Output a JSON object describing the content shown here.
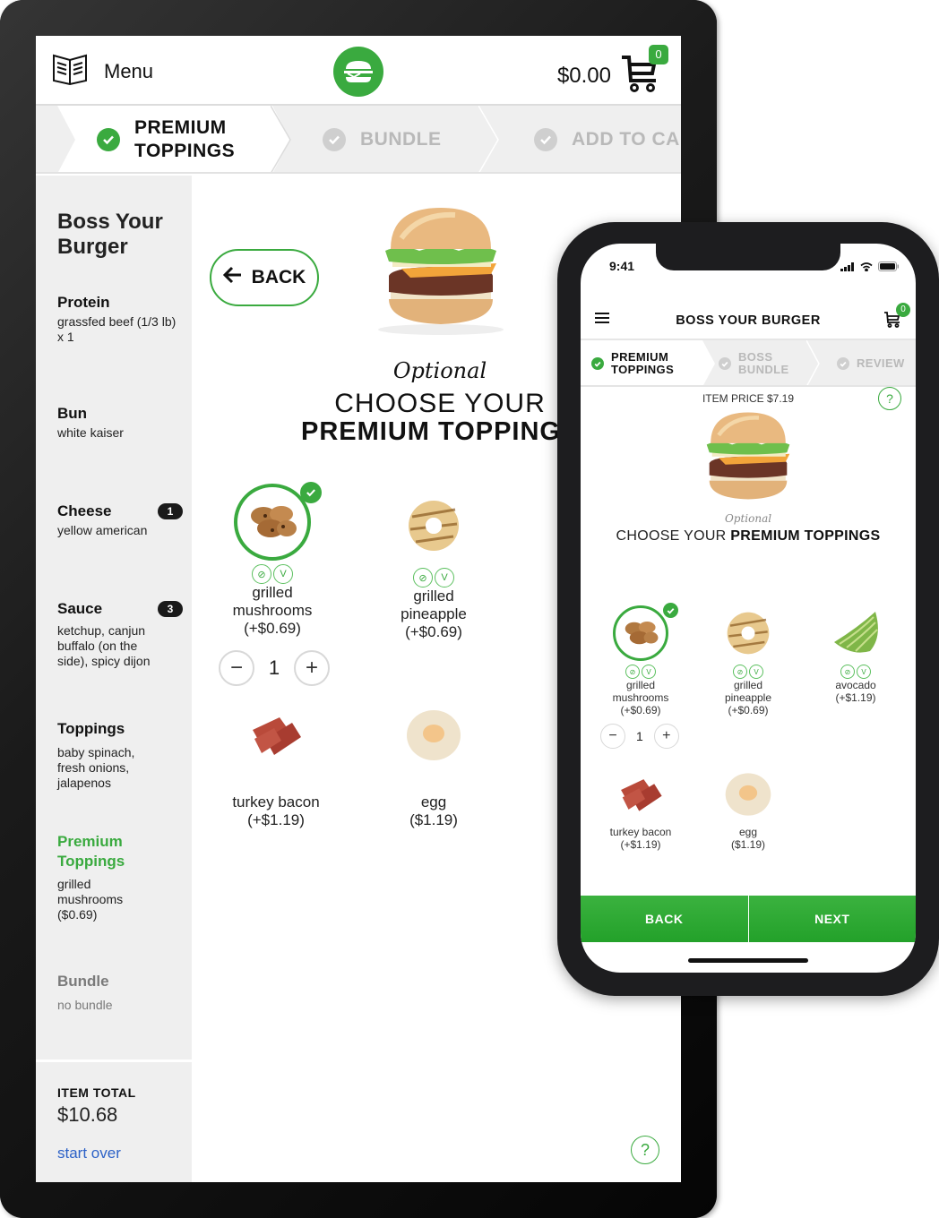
{
  "tablet": {
    "header": {
      "menu_label": "Menu",
      "cart_total": "$0.00",
      "cart_count": "0"
    },
    "steps": [
      {
        "line1": "PREMIUM",
        "line2": "TOPPINGS",
        "state": "active"
      },
      {
        "line1": "BUNDLE",
        "line2": "",
        "state": "inactive"
      },
      {
        "line1": "ADD TO CA",
        "line2": "",
        "state": "inactive"
      }
    ],
    "sidebar": {
      "title_line1": "Boss Your",
      "title_line2": "Burger",
      "sections": [
        {
          "title": "Protein",
          "value": "grassfed beef (1/3 lb) x 1",
          "badge": ""
        },
        {
          "title": "Bun",
          "value": "white kaiser",
          "badge": ""
        },
        {
          "title": "Cheese",
          "value": "yellow american",
          "badge": "1"
        },
        {
          "title": "Sauce",
          "value": "ketchup, canjun buffalo (on the side), spicy dijon",
          "badge": "3"
        },
        {
          "title": "Toppings",
          "value": "baby spinach, fresh onions, jalapenos",
          "badge": ""
        },
        {
          "title_line1": "Premium",
          "title_line2": "Toppings",
          "value": "grilled mushrooms ($0.69)",
          "badge": ""
        },
        {
          "title": "Bundle",
          "value": "no bundle",
          "badge": ""
        }
      ],
      "item_total_label": "ITEM TOTAL",
      "item_total": "$10.68",
      "start_over": "start over"
    },
    "main": {
      "back_label": "BACK",
      "optional": "Optional",
      "choose_line1": "CHOOSE YOUR",
      "choose_line2": "PREMIUM TOPPING",
      "items": [
        {
          "name_line1": "grilled",
          "name_line2": "mushrooms",
          "price": "(+$0.69)",
          "selected": true,
          "quantity": "1"
        },
        {
          "name_line1": "grilled",
          "name_line2": "pineapple",
          "price": "(+$0.69)",
          "selected": false
        },
        {
          "name_line1": "turkey bacon",
          "name_line2": "",
          "price": "(+$1.19)",
          "selected": false
        },
        {
          "name_line1": "egg",
          "name_line2": "",
          "price": "($1.19)",
          "selected": false
        }
      ],
      "help": "?"
    }
  },
  "phone": {
    "status": {
      "time": "9:41"
    },
    "header": {
      "title": "BOSS YOUR BURGER",
      "cart_count": "0"
    },
    "steps": [
      {
        "line1": "PREMIUM",
        "line2": "TOPPINGS",
        "state": "active"
      },
      {
        "line1": "BOSS",
        "line2": "BUNDLE",
        "state": "inactive"
      },
      {
        "line1": "REVIEW",
        "line2": "",
        "state": "inactive"
      }
    ],
    "item_price": "ITEM PRICE $7.19",
    "help": "?",
    "optional": "Optional",
    "choose_prefix": "CHOOSE YOUR ",
    "choose_bold": "PREMIUM TOPPINGS",
    "items": [
      {
        "name_line1": "grilled",
        "name_line2": "mushrooms",
        "price": "(+$0.69)",
        "selected": true,
        "quantity": "1"
      },
      {
        "name_line1": "grilled",
        "name_line2": "pineapple",
        "price": "(+$0.69)",
        "selected": false
      },
      {
        "name_line1": "avocado",
        "name_line2": "",
        "price": "(+$1.19)",
        "selected": false
      },
      {
        "name_line1": "turkey bacon",
        "name_line2": "",
        "price": "(+$1.19)",
        "selected": false
      },
      {
        "name_line1": "egg",
        "name_line2": "",
        "price": "($1.19)",
        "selected": false
      }
    ],
    "buttons": {
      "back": "BACK",
      "next": "NEXT"
    }
  },
  "colors": {
    "brand_green": "#3aaa3f",
    "link_blue": "#2d62c7",
    "inactive_gray": "#b9b9b9"
  }
}
